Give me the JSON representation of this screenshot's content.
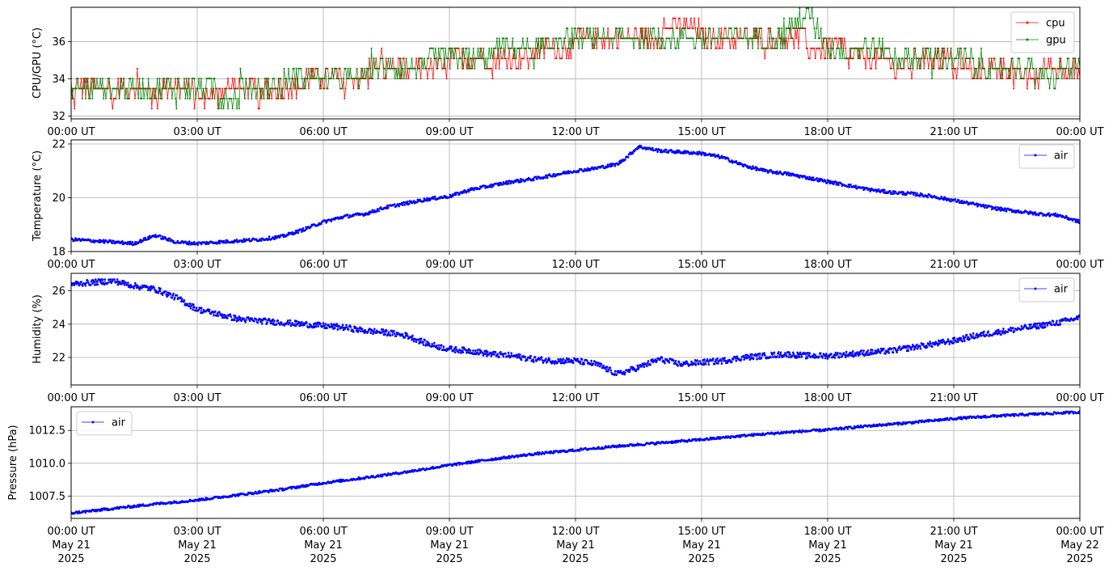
{
  "chart_data": [
    {
      "type": "line",
      "ylabel": "CPU/GPU (°C)",
      "xlabel": "",
      "x_ticks": [
        "00:00 UT",
        "03:00 UT",
        "06:00 UT",
        "09:00 UT",
        "12:00 UT",
        "15:00 UT",
        "18:00 UT",
        "21:00 UT",
        "00:00 UT"
      ],
      "x_range_hours": [
        0,
        24
      ],
      "ylim": [
        31.85,
        37.85
      ],
      "y_ticks": [
        32,
        34,
        36
      ],
      "grid": true,
      "legend": "upper right",
      "series": [
        {
          "name": "cpu",
          "color": "#ff0000",
          "x_hours": [
            0,
            0.5,
            1,
            1.5,
            2,
            2.5,
            3,
            3.5,
            4,
            4.5,
            5,
            5.5,
            6,
            6.5,
            7,
            7.5,
            8,
            8.5,
            9,
            9.5,
            10,
            10.5,
            11,
            11.5,
            12,
            12.5,
            13,
            13.5,
            14,
            14.5,
            15,
            15.5,
            16,
            16.5,
            17,
            17.5,
            18,
            18.5,
            19,
            19.5,
            20,
            20.5,
            21,
            21.5,
            22,
            22.5,
            23,
            23.5,
            24
          ],
          "values": [
            33.1,
            33.7,
            33.1,
            33.7,
            33.1,
            33.7,
            33.1,
            33.2,
            33.7,
            33.1,
            33.7,
            33.7,
            34.2,
            33.7,
            34.2,
            34.8,
            34.2,
            34.8,
            34.8,
            35.3,
            34.8,
            35.3,
            35.3,
            35.9,
            35.9,
            36.4,
            35.9,
            36.4,
            36.4,
            36.9,
            36.4,
            35.9,
            36.4,
            35.9,
            36.4,
            35.9,
            35.9,
            35.3,
            35.3,
            34.8,
            34.8,
            35.3,
            34.8,
            34.2,
            34.8,
            34.2,
            34.2,
            34.8,
            34.2
          ]
        },
        {
          "name": "gpu",
          "color": "#008000",
          "x_hours": [
            0,
            0.5,
            1,
            1.5,
            2,
            2.5,
            3,
            3.5,
            4,
            4.5,
            5,
            5.5,
            6,
            6.5,
            7,
            7.5,
            8,
            8.5,
            9,
            9.5,
            10,
            10.5,
            11,
            11.5,
            12,
            12.5,
            13,
            13.5,
            14,
            14.5,
            15,
            15.5,
            16,
            16.5,
            17,
            17.5,
            18,
            18.5,
            19,
            19.5,
            20,
            20.5,
            21,
            21.5,
            22,
            22.5,
            23,
            23.5,
            24
          ],
          "values": [
            33.7,
            33.2,
            33.7,
            33.2,
            33.7,
            33.2,
            33.7,
            33.2,
            33.2,
            33.7,
            33.7,
            34.2,
            33.7,
            34.2,
            34.2,
            34.8,
            34.8,
            34.8,
            35.3,
            34.8,
            35.3,
            35.9,
            35.3,
            35.9,
            36.4,
            35.9,
            36.4,
            36.4,
            36.4,
            36.4,
            35.9,
            36.4,
            36.4,
            35.9,
            36.4,
            37.5,
            35.9,
            35.3,
            35.9,
            35.3,
            35.3,
            34.8,
            35.3,
            34.8,
            34.2,
            34.8,
            34.2,
            34.2,
            34.8
          ]
        }
      ]
    },
    {
      "type": "line",
      "ylabel": "Temperature (°C)",
      "xlabel": "",
      "x_ticks": [
        "00:00 UT",
        "03:00 UT",
        "06:00 UT",
        "09:00 UT",
        "12:00 UT",
        "15:00 UT",
        "18:00 UT",
        "21:00 UT",
        "00:00 UT"
      ],
      "x_range_hours": [
        0,
        24
      ],
      "ylim": [
        18.0,
        22.15
      ],
      "y_ticks": [
        18,
        20,
        22
      ],
      "grid": true,
      "legend": "upper right",
      "series": [
        {
          "name": "air",
          "color": "#0000ff",
          "x_hours": [
            0,
            0.5,
            1,
            1.5,
            2,
            2.5,
            3,
            3.5,
            4,
            4.5,
            5,
            5.5,
            6,
            6.5,
            7,
            7.5,
            8,
            8.5,
            9,
            9.5,
            10,
            10.5,
            11,
            11.5,
            12,
            12.5,
            13,
            13.25,
            13.5,
            14,
            14.5,
            15,
            15.5,
            16,
            16.5,
            17,
            17.5,
            18,
            18.5,
            19,
            19.5,
            20,
            20.5,
            21,
            21.5,
            22,
            22.5,
            23,
            23.5,
            24
          ],
          "values": [
            18.45,
            18.4,
            18.35,
            18.3,
            18.6,
            18.35,
            18.3,
            18.35,
            18.4,
            18.45,
            18.55,
            18.8,
            19.1,
            19.3,
            19.4,
            19.65,
            19.8,
            19.95,
            20.05,
            20.3,
            20.45,
            20.6,
            20.7,
            20.85,
            21.0,
            21.1,
            21.25,
            21.55,
            21.9,
            21.75,
            21.7,
            21.65,
            21.5,
            21.2,
            21.0,
            20.9,
            20.75,
            20.6,
            20.45,
            20.3,
            20.2,
            20.15,
            20.05,
            19.9,
            19.75,
            19.6,
            19.5,
            19.4,
            19.35,
            19.1
          ]
        }
      ]
    },
    {
      "type": "line",
      "ylabel": "Humidity (%)",
      "xlabel": "",
      "x_ticks": [
        "00:00 UT",
        "03:00 UT",
        "06:00 UT",
        "09:00 UT",
        "12:00 UT",
        "15:00 UT",
        "18:00 UT",
        "21:00 UT",
        "00:00 UT"
      ],
      "x_range_hours": [
        0,
        24
      ],
      "ylim": [
        20.35,
        27.05
      ],
      "y_ticks": [
        22,
        24,
        26
      ],
      "grid": true,
      "legend": "upper right",
      "series": [
        {
          "name": "air",
          "color": "#0000ff",
          "x_hours": [
            0,
            0.5,
            1,
            1.5,
            2,
            2.5,
            3,
            3.5,
            4,
            4.5,
            5,
            5.5,
            6,
            6.5,
            7,
            7.5,
            8,
            8.5,
            9,
            9.5,
            10,
            10.5,
            11,
            11.5,
            12,
            12.5,
            13,
            13.5,
            14,
            14.5,
            15,
            15.5,
            16,
            16.5,
            17,
            17.5,
            18,
            18.5,
            19,
            19.5,
            20,
            20.5,
            21,
            21.5,
            22,
            22.5,
            23,
            23.5,
            24
          ],
          "values": [
            26.4,
            26.5,
            26.6,
            26.3,
            26.1,
            25.6,
            24.9,
            24.6,
            24.3,
            24.2,
            24.1,
            24.0,
            23.9,
            23.8,
            23.6,
            23.5,
            23.3,
            22.8,
            22.5,
            22.4,
            22.2,
            22.1,
            21.9,
            21.8,
            21.8,
            21.6,
            21.0,
            21.4,
            21.9,
            21.6,
            21.7,
            21.8,
            22.0,
            22.1,
            22.2,
            22.1,
            22.1,
            22.2,
            22.3,
            22.4,
            22.6,
            22.8,
            23.0,
            23.3,
            23.5,
            23.7,
            23.9,
            24.1,
            24.4
          ]
        }
      ]
    },
    {
      "type": "line",
      "ylabel": "Pressure (hPa)",
      "xlabel": "",
      "x_ticks": [
        "00:00 UT\nMay 21\n2025",
        "03:00 UT\nMay 21\n2025",
        "06:00 UT\nMay 21\n2025",
        "09:00 UT\nMay 21\n2025",
        "12:00 UT\nMay 21\n2025",
        "15:00 UT\nMay 21\n2025",
        "18:00 UT\nMay 21\n2025",
        "21:00 UT\nMay 21\n2025",
        "00:00 UT\nMay 22\n2025"
      ],
      "x_range_hours": [
        0,
        24
      ],
      "ylim": [
        1005.8,
        1014.3
      ],
      "y_ticks": [
        "1007.5",
        "1010.0",
        "1012.5"
      ],
      "grid": true,
      "legend": "upper left",
      "series": [
        {
          "name": "air",
          "color": "#0000ff",
          "x_hours": [
            0,
            1,
            2,
            3,
            4,
            5,
            6,
            7,
            8,
            9,
            10,
            11,
            12,
            13,
            14,
            15,
            16,
            17,
            18,
            19,
            20,
            21,
            22,
            23,
            24
          ],
          "values": [
            1006.2,
            1006.55,
            1006.9,
            1007.2,
            1007.6,
            1008.0,
            1008.5,
            1008.9,
            1009.35,
            1009.85,
            1010.3,
            1010.7,
            1011.0,
            1011.3,
            1011.55,
            1011.8,
            1012.1,
            1012.35,
            1012.55,
            1012.85,
            1013.1,
            1013.4,
            1013.6,
            1013.75,
            1013.9
          ]
        }
      ]
    }
  ]
}
